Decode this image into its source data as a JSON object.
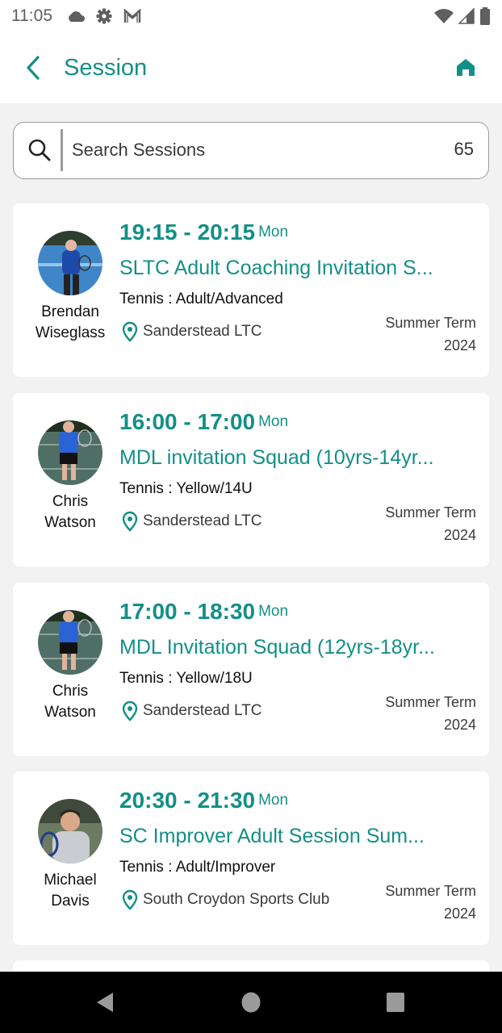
{
  "status_bar": {
    "time": "11:05",
    "left_icons": [
      "cloud-icon",
      "settings-icon",
      "gmail-icon"
    ],
    "right_icons": [
      "wifi-icon",
      "signal-icon",
      "battery-icon"
    ]
  },
  "header": {
    "title": "Session",
    "back_icon": "chevron-left-icon",
    "home_icon": "home-icon"
  },
  "search": {
    "placeholder": "Search Sessions",
    "value": "",
    "count": "65"
  },
  "colors": {
    "accent": "#138f88",
    "background": "#f2f2f2",
    "card": "#ffffff"
  },
  "sessions": [
    {
      "coach_first": "Brendan",
      "coach_last": "Wiseglass",
      "time_range": "19:15 - 20:15",
      "day": "Mon",
      "title": "SLTC Adult Coaching Invitation S...",
      "sport_level": "Tennis : Adult/Advanced",
      "venue": "Sanderstead LTC",
      "term": "Summer Term",
      "year": "2024"
    },
    {
      "coach_first": "Chris",
      "coach_last": "Watson",
      "time_range": "16:00 - 17:00",
      "day": "Mon",
      "title": "MDL invitation Squad (10yrs-14yr...",
      "sport_level": "Tennis : Yellow/14U",
      "venue": "Sanderstead LTC",
      "term": "Summer Term",
      "year": "2024"
    },
    {
      "coach_first": "Chris",
      "coach_last": "Watson",
      "time_range": "17:00 - 18:30",
      "day": "Mon",
      "title": "MDL Invitation Squad (12yrs-18yr...",
      "sport_level": "Tennis : Yellow/18U",
      "venue": "Sanderstead LTC",
      "term": "Summer Term",
      "year": "2024"
    },
    {
      "coach_first": "Michael",
      "coach_last": "Davis",
      "time_range": "20:30 - 21:30",
      "day": "Mon",
      "title": "SC Improver Adult Session Sum...",
      "sport_level": "Tennis : Adult/Improver",
      "venue": "South Croydon Sports Club",
      "term": "Summer Term",
      "year": "2024"
    }
  ],
  "nav_bar": {
    "buttons": [
      "back-triangle-icon",
      "home-circle-icon",
      "recents-square-icon"
    ]
  }
}
